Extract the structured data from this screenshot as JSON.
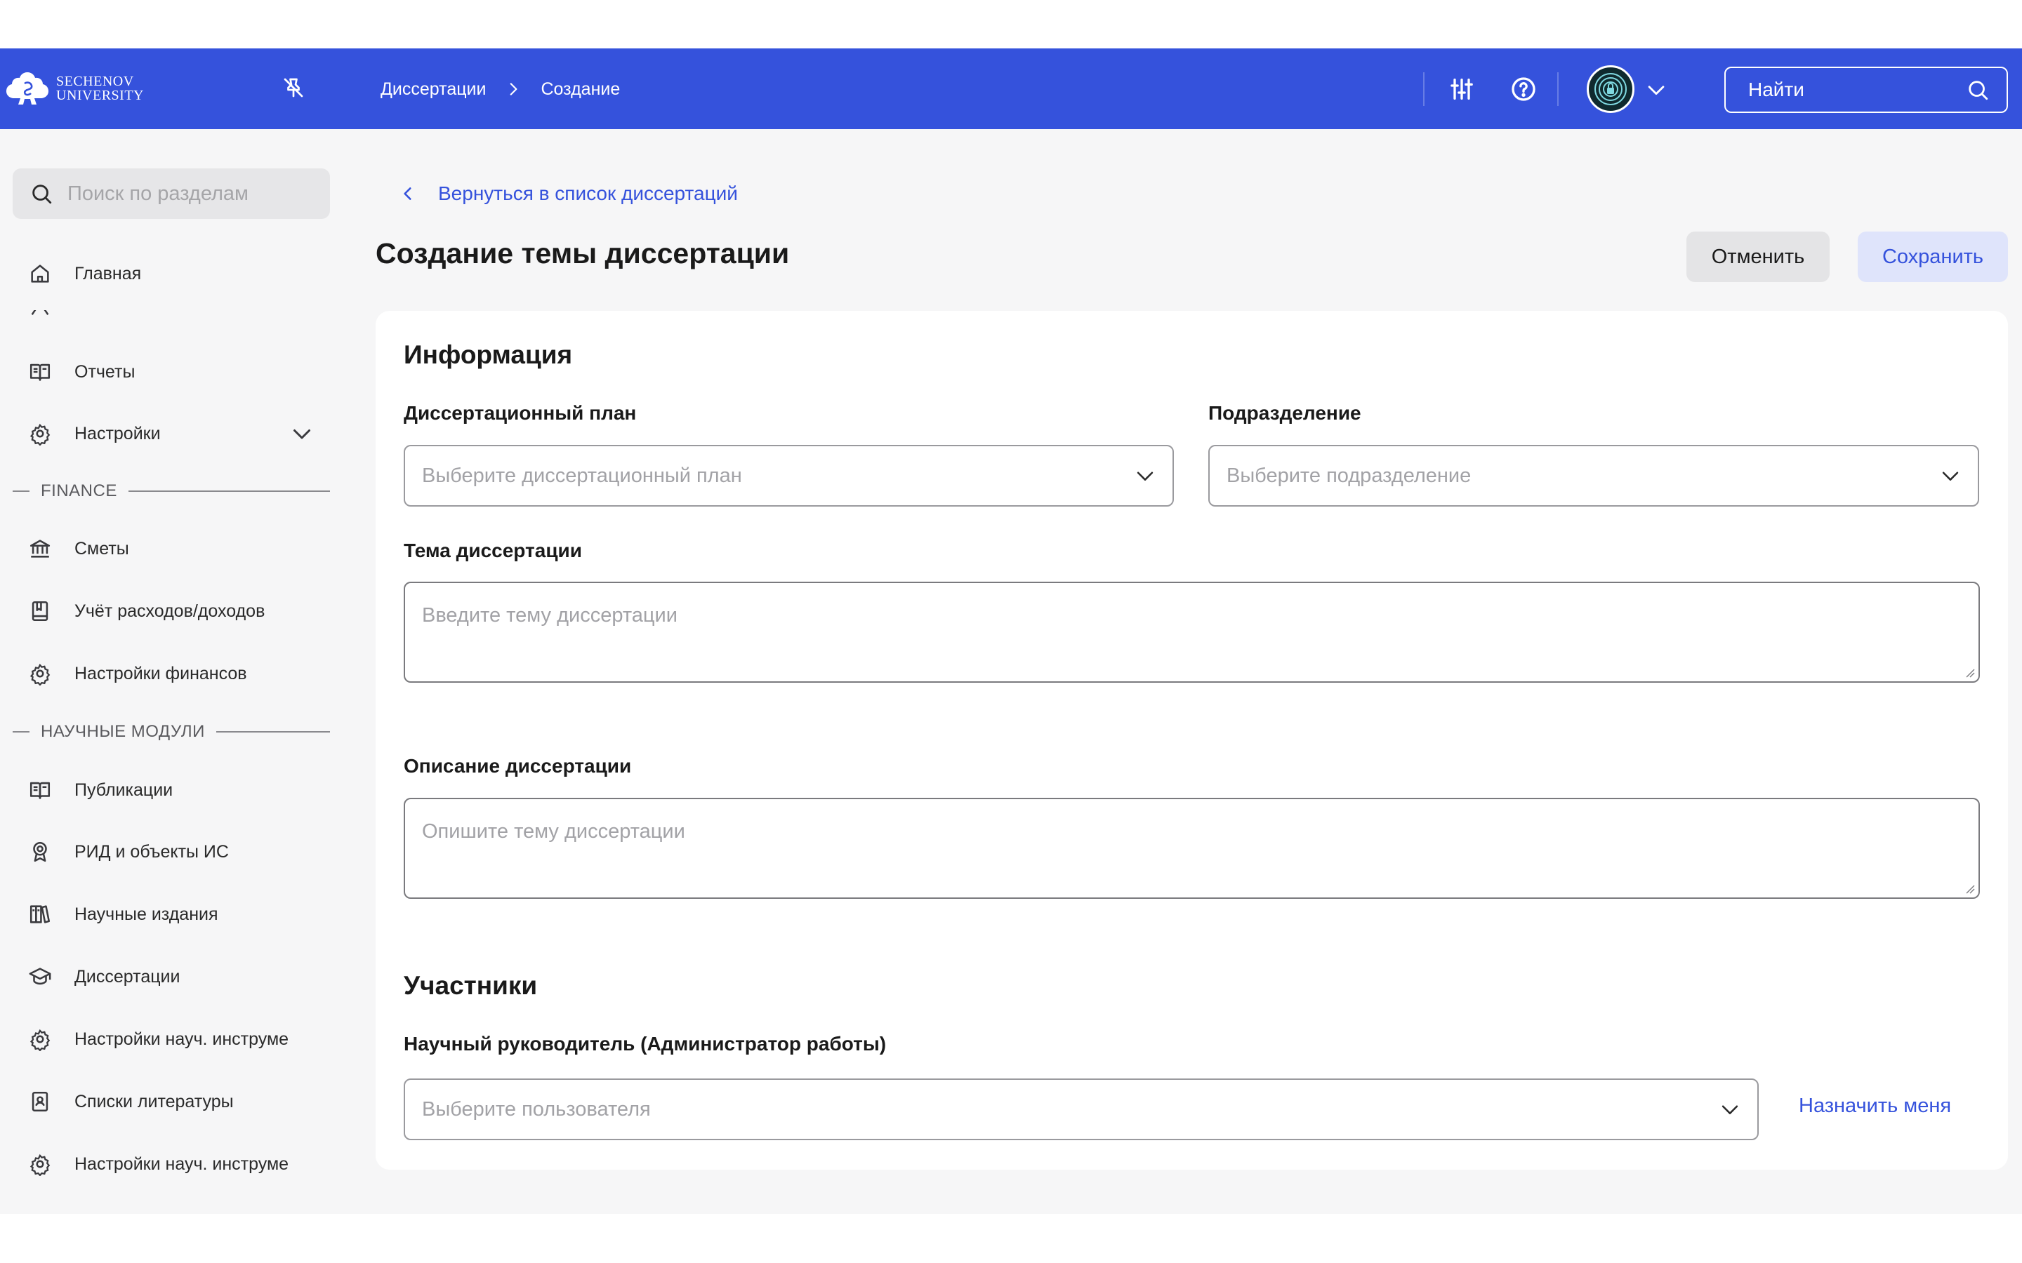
{
  "header": {
    "logo_line1": "Sechenov",
    "logo_line2": "University",
    "breadcrumb": [
      "Диссертации",
      "Создание"
    ],
    "search_placeholder": "Найти"
  },
  "sidebar": {
    "search_placeholder": "Поиск по разделам",
    "items": [
      {
        "label": "Главная",
        "icon": "home-icon"
      },
      {
        "label": "Отчеты",
        "icon": "book-open-icon"
      },
      {
        "label": "Настройки",
        "icon": "gear-icon"
      }
    ],
    "finance_section": "FINANCE",
    "finance_items": [
      {
        "label": "Сметы",
        "icon": "bank-icon"
      },
      {
        "label": "Учёт расходов/доходов",
        "icon": "ledger-icon"
      },
      {
        "label": "Настройки финансов",
        "icon": "gear-icon"
      }
    ],
    "science_section": "НАУЧНЫЕ МОДУЛИ",
    "science_items": [
      {
        "label": "Публикации",
        "icon": "book-open-icon"
      },
      {
        "label": "РИД и объекты ИС",
        "icon": "award-icon"
      },
      {
        "label": "Научные издания",
        "icon": "books-icon"
      },
      {
        "label": "Диссертации",
        "icon": "graduation-cap-icon"
      },
      {
        "label": "Настройки науч. инструме",
        "icon": "gear-icon"
      },
      {
        "label": "Списки литературы",
        "icon": "contacts-book-icon"
      },
      {
        "label": "Настройки науч. инструме",
        "icon": "gear-icon"
      }
    ]
  },
  "main": {
    "back_link": "Вернуться в список диссертаций",
    "title": "Создание темы диссертации",
    "cancel_label": "Отменить",
    "save_label": "Сохранить",
    "info_heading": "Информация",
    "plan_label": "Диссертационный план",
    "plan_placeholder": "Выберите диссертационный план",
    "department_label": "Подразделение",
    "department_placeholder": "Выберите подразделение",
    "topic_label": "Тема диссертации",
    "topic_placeholder": "Введите тему диссертации",
    "description_label": "Описание диссертации",
    "description_placeholder": "Опишите тему диссертации",
    "participants_heading": "Участники",
    "supervisor_label": "Научный руководитель (Администратор работы)",
    "supervisor_placeholder": "Выберите пользователя",
    "assign_me_label": "Назначить меня"
  },
  "colors": {
    "brand": "#3552dc",
    "content_bg": "#f6f6f7",
    "card_bg": "#ffffff"
  }
}
